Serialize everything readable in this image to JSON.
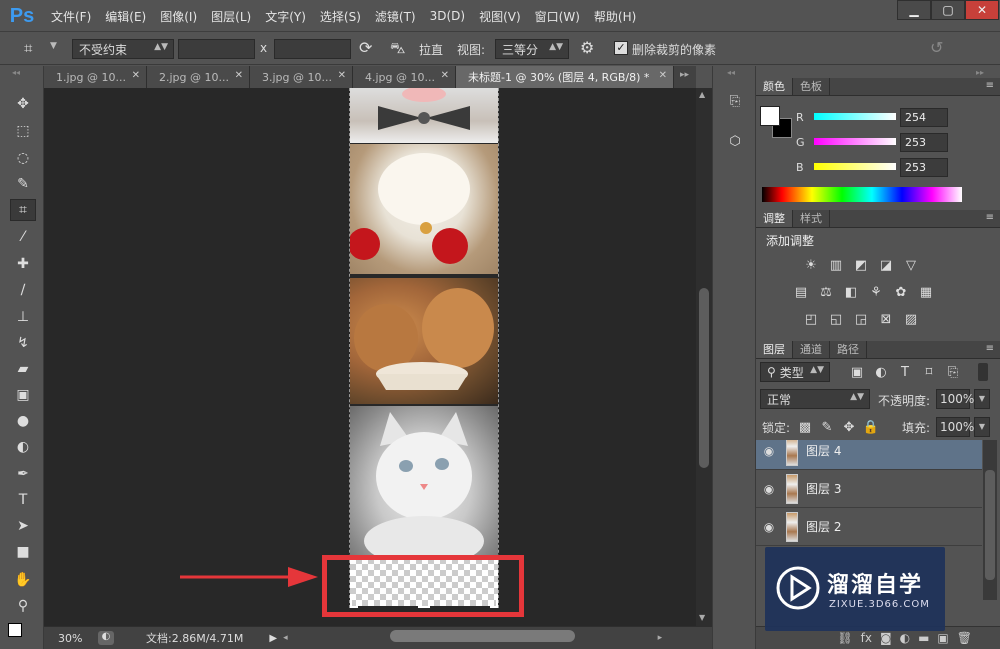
{
  "app": {
    "logo": "Ps"
  },
  "menu": [
    "文件(F)",
    "编辑(E)",
    "图像(I)",
    "图层(L)",
    "文字(Y)",
    "选择(S)",
    "滤镜(T)",
    "3D(D)",
    "视图(V)",
    "窗口(W)",
    "帮助(H)"
  ],
  "window_controls": {
    "minimize": "▁",
    "maximize": "▢",
    "close": "✕"
  },
  "options": {
    "ratio_select": "不受约束",
    "width_value": "",
    "x_label": "x",
    "height_value": "",
    "straighten_label": "拉直",
    "view_label": "视图:",
    "view_select": "三等分",
    "delete_cropped_checked": true,
    "delete_cropped_label": "删除裁剪的像素"
  },
  "tools": [
    "move-icon",
    "marquee-icon",
    "lasso-icon",
    "quick-select-icon",
    "crop-icon",
    "eyedropper-icon",
    "healing-icon",
    "brush-icon",
    "stamp-icon",
    "history-brush-icon",
    "eraser-icon",
    "gradient-icon",
    "blur-icon",
    "dodge-icon",
    "pen-icon",
    "text-icon",
    "path-select-icon",
    "shape-icon",
    "hand-icon",
    "zoom-icon"
  ],
  "tabs": [
    {
      "label": "1.jpg @ 10...",
      "active": false
    },
    {
      "label": "2.jpg @ 10...",
      "active": false
    },
    {
      "label": "3.jpg @ 10...",
      "active": false
    },
    {
      "label": "4.jpg @ 10...",
      "active": false
    },
    {
      "label": "未标题-1 @ 30% (图层 4, RGB/8) *",
      "active": true
    }
  ],
  "status": {
    "zoom": "30%",
    "doc_info": "文档:2.86M/4.71M"
  },
  "color_panel": {
    "tabs": [
      "颜色",
      "色板"
    ],
    "R": "254",
    "G": "253",
    "B": "253",
    "r_label": "R",
    "g_label": "G",
    "b_label": "B"
  },
  "adjust_panel": {
    "tabs": [
      "调整",
      "样式"
    ],
    "title": "添加调整"
  },
  "layers_panel": {
    "tabs": [
      "图层",
      "通道",
      "路径"
    ],
    "filter_label": "类型",
    "blend_mode": "正常",
    "opacity_label": "不透明度:",
    "opacity_value": "100%",
    "lock_label": "锁定:",
    "fill_label": "填充:",
    "fill_value": "100%",
    "layers": [
      {
        "name": "图层 4",
        "selected": true
      },
      {
        "name": "图层 3",
        "selected": false
      },
      {
        "name": "图层 2",
        "selected": false
      }
    ]
  },
  "watermark": {
    "brand": "溜溜自学",
    "url": "ZIXUE.3D66.COM"
  },
  "colors": {
    "accent_red": "#e5363a",
    "selected_layer": "#5f7389",
    "ps_blue": "#3d9bf0"
  }
}
